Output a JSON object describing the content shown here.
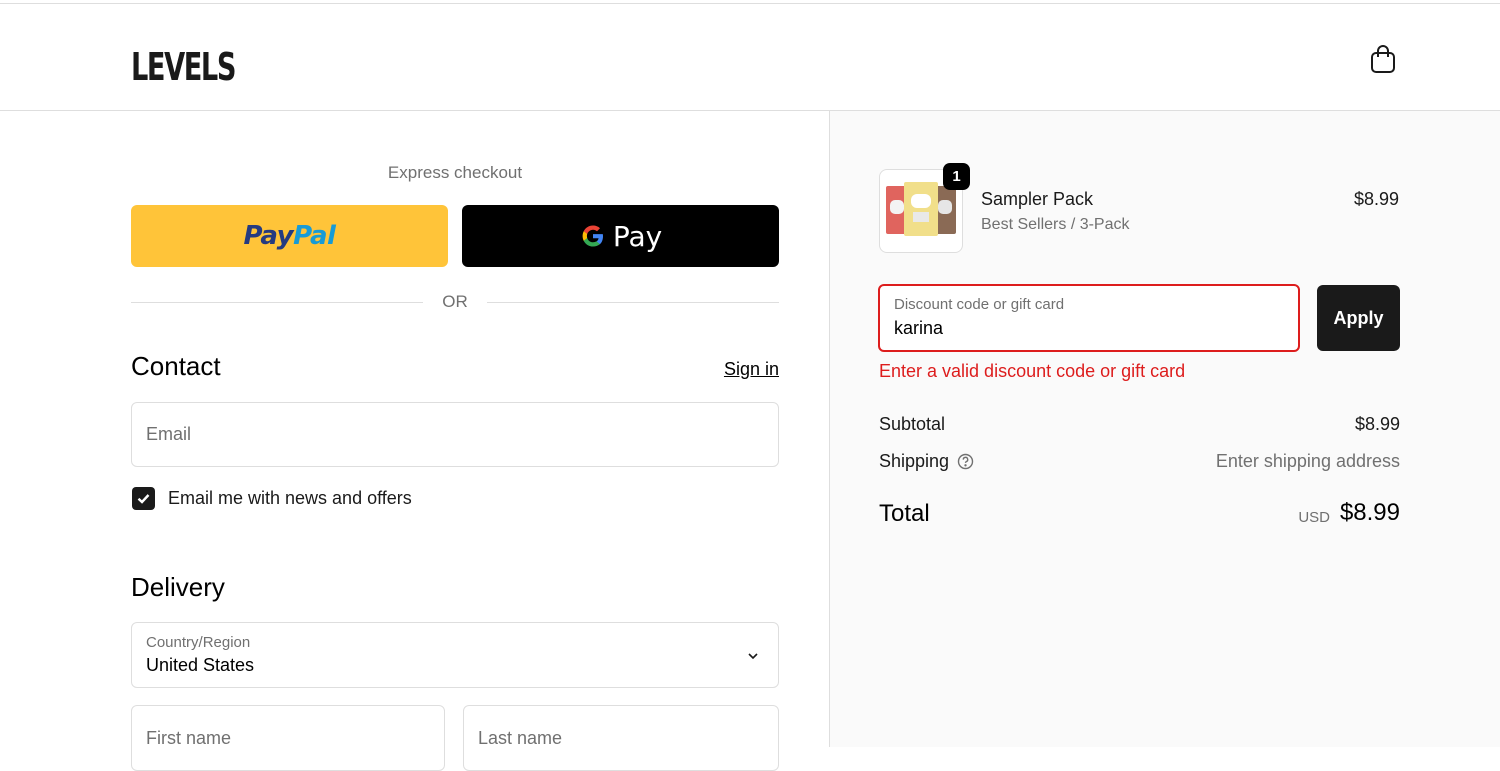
{
  "header": {
    "brand": "LEVELS",
    "cart_icon": "shopping-bag-icon"
  },
  "checkout": {
    "express_label": "Express checkout",
    "paypal": {
      "part1": "Pay",
      "part2": "Pal"
    },
    "gpay": {
      "label": "Pay"
    },
    "or_label": "OR"
  },
  "contact": {
    "title": "Contact",
    "sign_in": "Sign in",
    "email_placeholder": "Email",
    "newsletter_label": "Email me with news and offers",
    "newsletter_checked": true
  },
  "delivery": {
    "title": "Delivery",
    "country_label": "Country/Region",
    "country_value": "United States",
    "first_name_placeholder": "First name",
    "last_name_placeholder": "Last name"
  },
  "summary": {
    "item": {
      "quantity": "1",
      "name": "Sampler Pack",
      "variant": "Best Sellers / 3-Pack",
      "price": "$8.99"
    },
    "discount": {
      "label": "Discount code or gift card",
      "value": "karina",
      "apply_label": "Apply",
      "error": "Enter a valid discount code or gift card"
    },
    "subtotal_label": "Subtotal",
    "subtotal_value": "$8.99",
    "shipping_label": "Shipping",
    "shipping_value": "Enter shipping address",
    "total_label": "Total",
    "total_currency": "USD",
    "total_value": "$8.99"
  },
  "colors": {
    "paypal_yellow": "#ffc439",
    "error_red": "#dd1d1d",
    "dark": "#1a1a1a"
  }
}
